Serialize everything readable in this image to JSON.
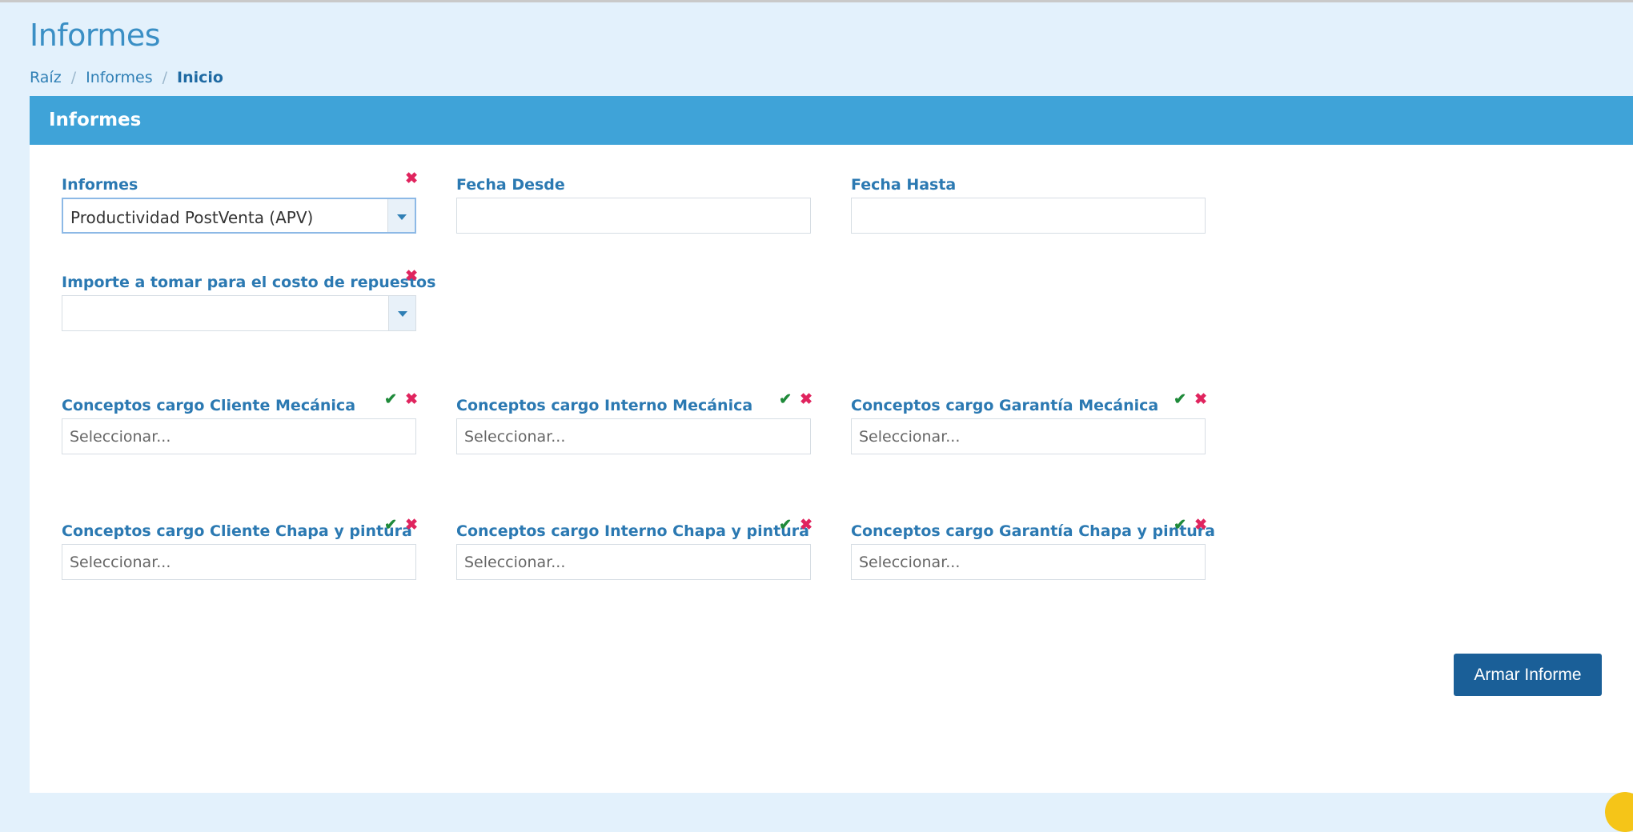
{
  "page": {
    "title": "Informes"
  },
  "breadcrumb": {
    "items": [
      "Raíz",
      "Informes"
    ],
    "separator": "/",
    "current": "Inicio"
  },
  "panel": {
    "title": "Informes"
  },
  "icons": {
    "clear": "✖",
    "confirm": "✔"
  },
  "fields": {
    "informes": {
      "label": "Informes",
      "value": "Productividad PostVenta (APV)"
    },
    "fecha_desde": {
      "label": "Fecha Desde",
      "value": ""
    },
    "fecha_hasta": {
      "label": "Fecha Hasta",
      "value": ""
    },
    "importe": {
      "label": "Importe a tomar para el costo de repuestos",
      "value": ""
    },
    "cliente_mecanica": {
      "label": "Conceptos cargo Cliente Mecánica",
      "placeholder": "Seleccionar..."
    },
    "interno_mecanica": {
      "label": "Conceptos cargo Interno Mecánica",
      "placeholder": "Seleccionar..."
    },
    "garantia_mecanica": {
      "label": "Conceptos cargo Garantía Mecánica",
      "placeholder": "Seleccionar..."
    },
    "cliente_chapa": {
      "label": "Conceptos cargo Cliente Chapa y pintura",
      "placeholder": "Seleccionar..."
    },
    "interno_chapa": {
      "label": "Conceptos cargo Interno Chapa y pintura",
      "placeholder": "Seleccionar..."
    },
    "garantia_chapa": {
      "label": "Conceptos cargo Garantía Chapa y pintura",
      "placeholder": "Seleccionar..."
    }
  },
  "actions": {
    "submit_label": "Armar Informe"
  },
  "colors": {
    "header": "#3fa3d8",
    "button": "#1a5f98",
    "label": "#2b79b2",
    "clear_icon": "#e0245e",
    "confirm_icon": "#1f8a3a",
    "background": "#e3f1fc"
  }
}
